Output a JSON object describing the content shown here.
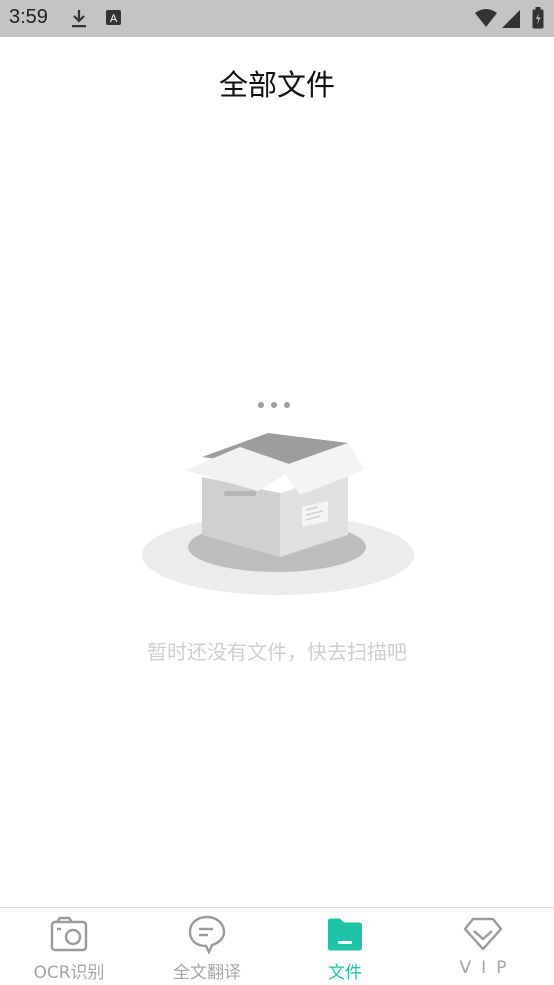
{
  "status_bar": {
    "time": "3:59",
    "icons": [
      "download-icon",
      "text-a-icon",
      "wifi-icon",
      "signal-icon",
      "battery-icon"
    ]
  },
  "header": {
    "title": "全部文件"
  },
  "empty_state": {
    "message": "暂时还没有文件，快去扫描吧",
    "illustration": "open-box-icon"
  },
  "bottom_nav": {
    "items": [
      {
        "label": "OCR识别",
        "icon": "camera-icon",
        "active": false
      },
      {
        "label": "全文翻译",
        "icon": "chat-bubble-icon",
        "active": false
      },
      {
        "label": "文件",
        "icon": "folder-icon",
        "active": true
      },
      {
        "label": "VIP",
        "icon": "diamond-icon",
        "active": false
      }
    ]
  },
  "colors": {
    "status_bar_bg": "#c4c4c4",
    "accent": "#1fc4a7",
    "inactive": "#a6a6a6",
    "empty_text": "#cfcfcf"
  }
}
